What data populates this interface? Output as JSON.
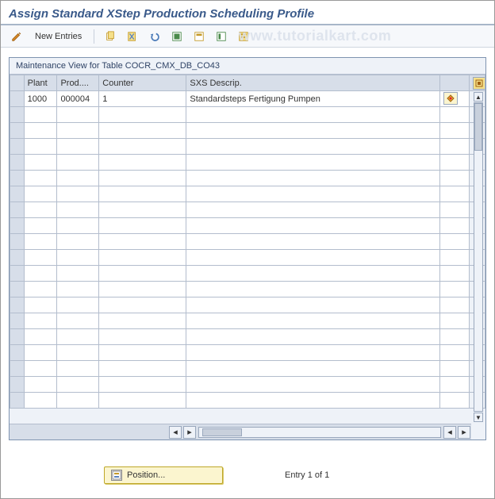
{
  "title": "Assign Standard XStep Production Scheduling Profile",
  "watermark": "www.tutorialkart.com",
  "toolbar": {
    "new_entries": "New Entries"
  },
  "panel": {
    "caption": "Maintenance View for Table COCR_CMX_DB_CO43",
    "columns": {
      "plant": "Plant",
      "prod": "Prod....",
      "counter": "Counter",
      "sxs": "SXS Descrip."
    },
    "rows": [
      {
        "plant": "1000",
        "prod": "000004",
        "counter": "1",
        "sxs": "Standardsteps Fertigung  Pumpen"
      }
    ]
  },
  "footer": {
    "position_label": "Position...",
    "entry_text": "Entry 1 of 1"
  }
}
